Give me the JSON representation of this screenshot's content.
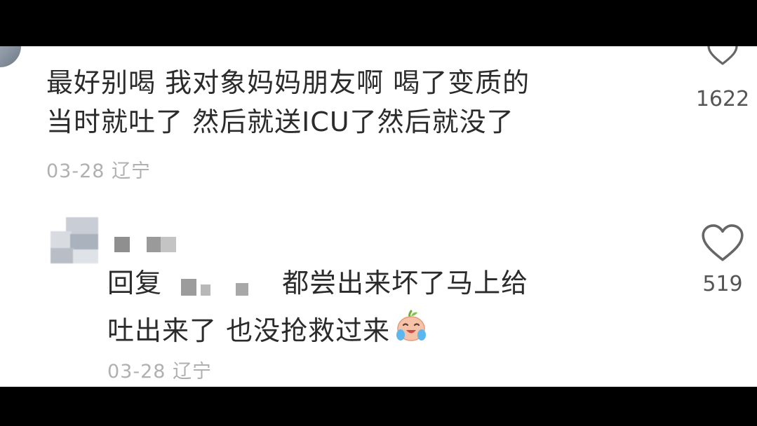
{
  "comment": {
    "text": "最好别喝 我对象妈妈朋友啊 喝了变质的\n当时就吐了 然后就送ICU了然后就没了",
    "date": "03-28",
    "location": "辽宁",
    "like_count": "1622",
    "like_icon": "heart-outline-icon"
  },
  "reply": {
    "prefix": "回复",
    "text_line1": "都尝出来坏了马上给",
    "text_line2": "吐出来了 也没抢救过来",
    "emoji": "crying-laughing-face-icon",
    "date": "03-28",
    "location": "辽宁",
    "like_count": "519",
    "like_icon": "heart-outline-icon"
  },
  "colors": {
    "text": "#2b2b2b",
    "meta": "#b0b0b0",
    "like_count": "#555555",
    "letterbox": "#000000",
    "background": "#ffffff"
  }
}
